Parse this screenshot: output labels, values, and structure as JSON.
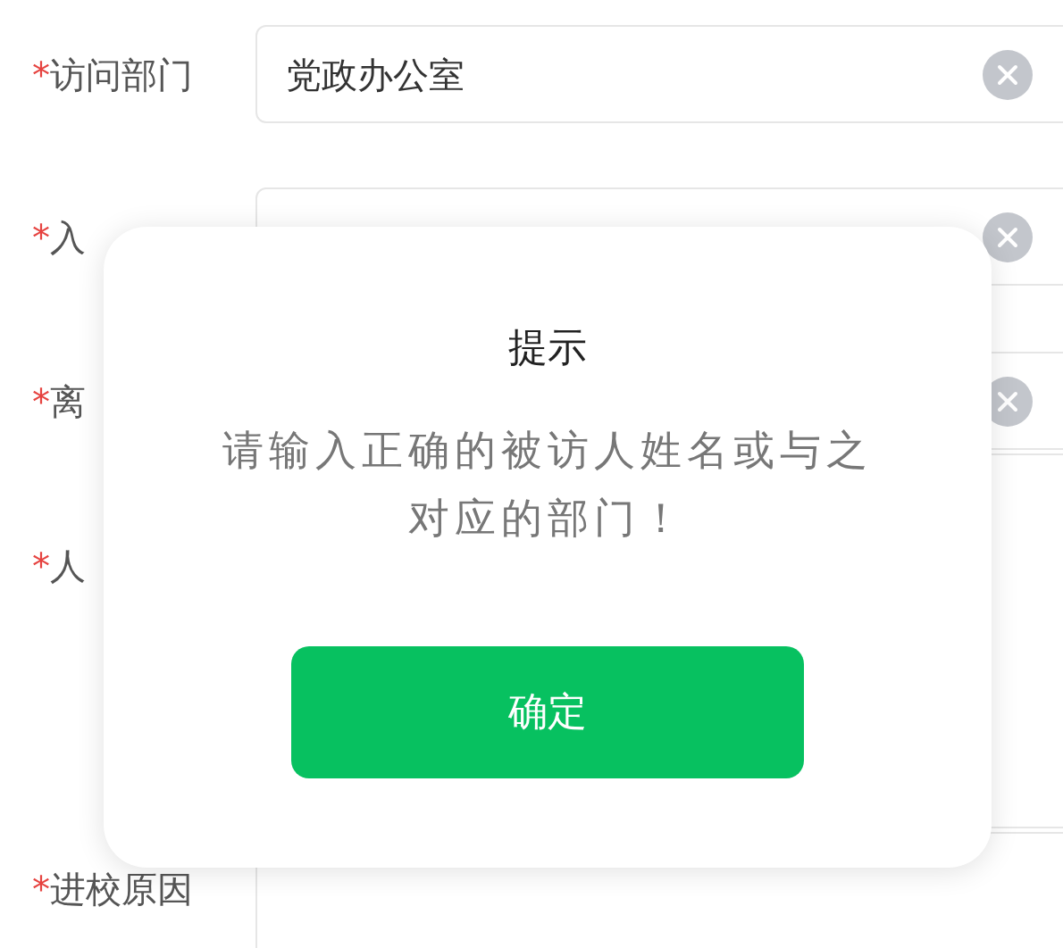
{
  "form": {
    "fields": [
      {
        "label": "访问部门",
        "mark": "*",
        "value": "党政办公室",
        "clearable": true,
        "kind": "line"
      },
      {
        "label": "入",
        "mark": "*",
        "clearable": true,
        "kind": "line"
      },
      {
        "label": "离",
        "mark": "*",
        "clearable": true,
        "kind": "line"
      },
      {
        "label": "人",
        "mark": "*",
        "clearable": false,
        "kind": "area"
      },
      {
        "label": "进校原因",
        "mark": "*",
        "clearable": false,
        "kind": "bottom"
      }
    ]
  },
  "dialog": {
    "title": "提示",
    "message": "请输入正确的被访人姓名或与之对应的部门！",
    "button": "确定"
  }
}
